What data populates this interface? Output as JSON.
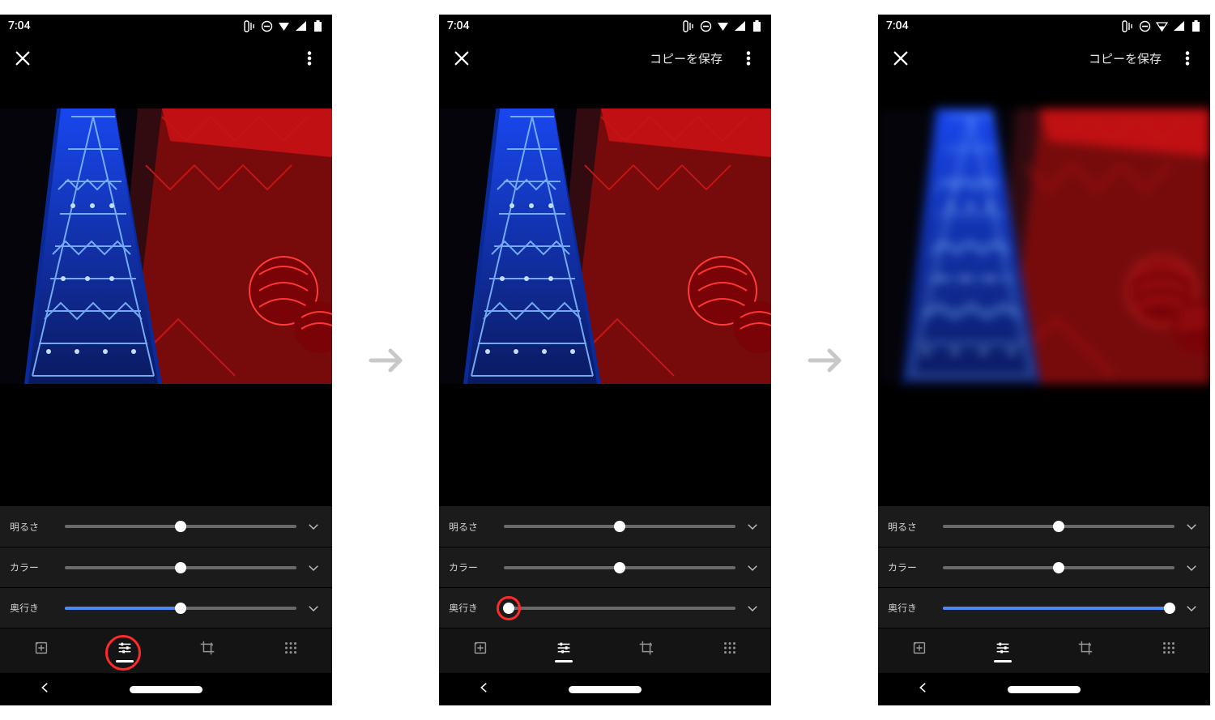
{
  "status": {
    "time": "7:04"
  },
  "appbar": {
    "save_copy": "コピーを保存"
  },
  "sliders": [
    {
      "label": "明るさ",
      "value": 50,
      "accent": false
    },
    {
      "label": "カラー",
      "value": 50,
      "accent": false
    },
    {
      "label": "奥行き",
      "value": 50,
      "accent": true
    }
  ],
  "screens": [
    {
      "show_save": false,
      "blurred": false,
      "depth_value": 50,
      "ring": {
        "target": "tab-adjust",
        "size": 44
      }
    },
    {
      "show_save": true,
      "blurred": false,
      "depth_value": 2,
      "ring": {
        "target": "depth-thumb",
        "size": 32
      }
    },
    {
      "show_save": true,
      "blurred": true,
      "depth_value": 98,
      "ring": null
    }
  ],
  "tabs": {
    "items": [
      "auto-enhance",
      "adjust",
      "crop",
      "more"
    ],
    "active": "adjust"
  },
  "icons": {
    "close": "close-icon",
    "more": "more-vert-icon",
    "chevron_down": "chevron-down-icon"
  }
}
